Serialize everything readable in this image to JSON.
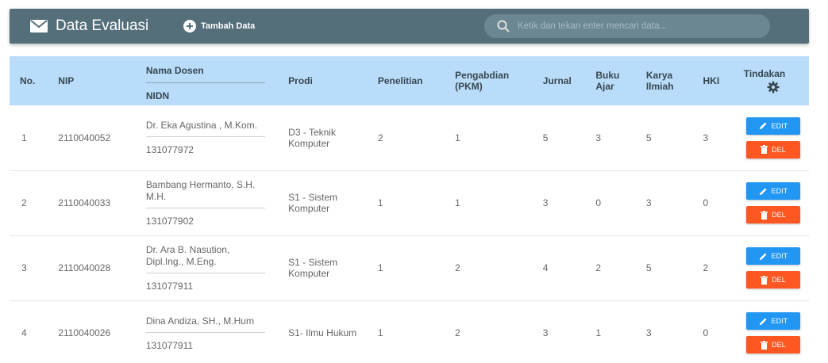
{
  "header": {
    "title": "Data Evaluasi",
    "add_label": "Tambah Data",
    "search_placeholder": "Ketik dan tekan enter mencari data...",
    "search_value": ""
  },
  "table": {
    "columns": {
      "no": "No.",
      "nip": "NIP",
      "nama_dosen": "Nama Dosen",
      "nidn": "NIDN",
      "prodi": "Prodi",
      "penelitian": "Penelitian",
      "pengabdian": "Pengabdian (PKM)",
      "jurnal": "Jurnal",
      "buku_ajar": "Buku Ajar",
      "karya_ilmiah": "Karya Ilmiah",
      "hki": "HKI",
      "tindakan": "Tindakan"
    },
    "edit_label": "EDIT",
    "del_label": "DEL",
    "rows": [
      {
        "no": "1",
        "nip": "2110040052",
        "nama": "Dr. Eka Agustina , M.Kom.",
        "nidn": "131077972",
        "prodi": "D3 - Teknik Komputer",
        "penelitian": "2",
        "pengabdian": "1",
        "jurnal": "5",
        "buku_ajar": "3",
        "karya_ilmiah": "5",
        "hki": "3"
      },
      {
        "no": "2",
        "nip": "2110040033",
        "nama": "Bambang Hermanto, S.H. M.H.",
        "nidn": "131077902",
        "prodi": "S1 - Sistem Komputer",
        "penelitian": "1",
        "pengabdian": "1",
        "jurnal": "3",
        "buku_ajar": "0",
        "karya_ilmiah": "3",
        "hki": "0"
      },
      {
        "no": "3",
        "nip": "2110040028",
        "nama": "Dr. Ara B. Nasution, Dipl.Ing., M.Eng.",
        "nidn": "131077911",
        "prodi": "S1 - Sistem Komputer",
        "penelitian": "1",
        "pengabdian": "2",
        "jurnal": "4",
        "buku_ajar": "2",
        "karya_ilmiah": "5",
        "hki": "2"
      },
      {
        "no": "4",
        "nip": "2110040026",
        "nama": "Dina Andiza, SH., M.Hum",
        "nidn": "131077911",
        "prodi": "S1- Ilmu Hukum",
        "penelitian": "1",
        "pengabdian": "2",
        "jurnal": "3",
        "buku_ajar": "1",
        "karya_ilmiah": "3",
        "hki": "0"
      }
    ]
  },
  "colors": {
    "topbar": "#546e7a",
    "table_header": "#b9dcfa",
    "edit_button": "#2196f3",
    "delete_button": "#ff5722"
  },
  "icons": {
    "title": "mail-icon",
    "add": "plus-circle-icon",
    "search": "search-icon",
    "settings": "gear-icon",
    "edit": "pencil-icon",
    "delete": "trash-icon"
  }
}
